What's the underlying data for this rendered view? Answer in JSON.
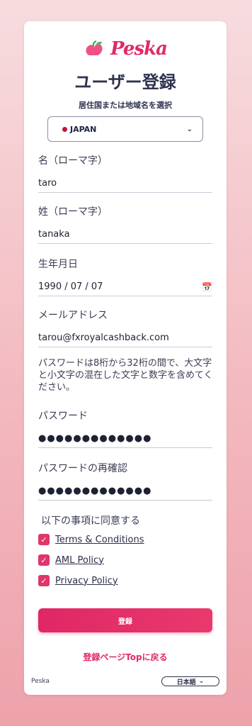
{
  "brand": {
    "logo_text": "Pesk",
    "logo_text_2": "a"
  },
  "page": {
    "title": "ユーザー登録",
    "country_prompt": "居住国または地域名を選択"
  },
  "country_select": {
    "value": "JAPAN"
  },
  "fields": {
    "first_name": {
      "label": "名（ローマ字）",
      "value": "taro"
    },
    "last_name": {
      "label": "姓（ローマ字）",
      "value": "tanaka"
    },
    "birthdate": {
      "label": "生年月日",
      "value": "1990 / 07 / 07"
    },
    "email": {
      "label": "メールアドレス",
      "value": "tarou@fxroyalcashback.com"
    },
    "password": {
      "label": "パスワード",
      "value": "●●●●●●●●●●●●●"
    },
    "password_confirm": {
      "label": "パスワードの再確認",
      "value": "●●●●●●●●●●●●●"
    }
  },
  "password_notice": "パスワードは8桁から32桁の間で、大文字と小文字の混在した文字と数字を含めてください。",
  "agreements": {
    "title": "以下の事項に同意する",
    "items": [
      {
        "label": "Terms & Conditions",
        "checked": true
      },
      {
        "label": "AML Policy",
        "checked": true
      },
      {
        "label": "Privacy Policy",
        "checked": true
      }
    ]
  },
  "actions": {
    "register_label": "登録",
    "back_link": "登録ページTopに戻る"
  },
  "footer": {
    "brand": "Peska",
    "language": "日本語"
  },
  "colors": {
    "accent": "#e02969",
    "text": "#2f3350"
  }
}
